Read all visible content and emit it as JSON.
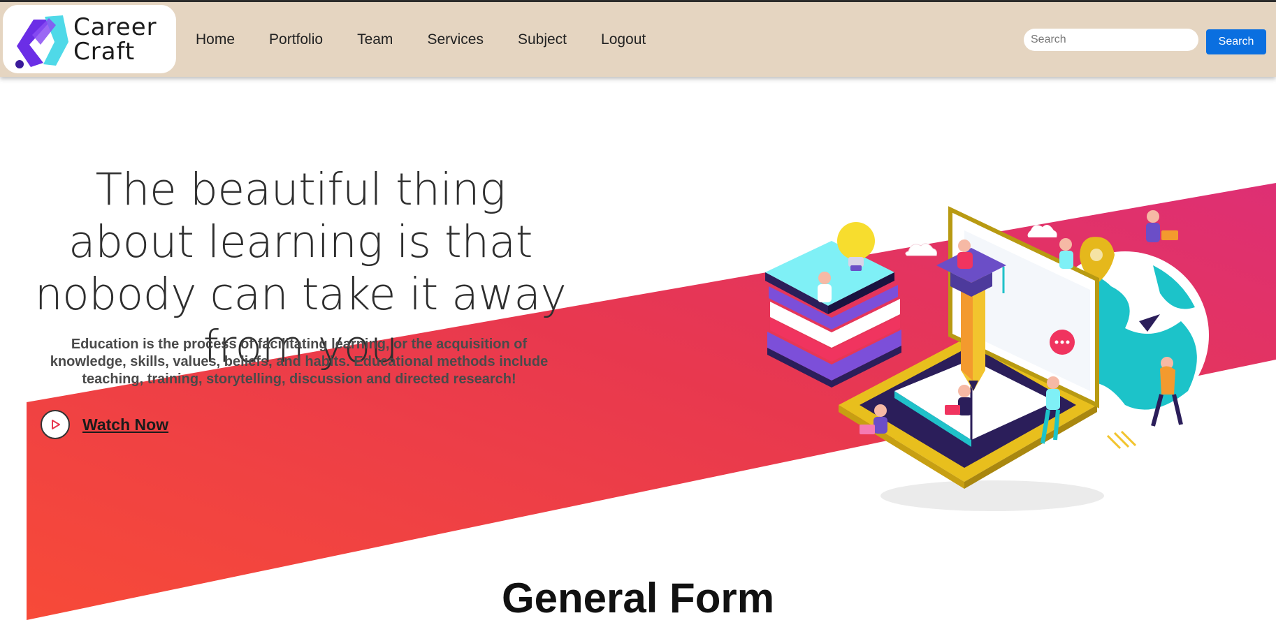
{
  "brand": {
    "line1": "Career",
    "line2": "Craft"
  },
  "nav": {
    "items": [
      "Home",
      "Portfolio",
      "Team",
      "Services",
      "Subject",
      "Logout"
    ]
  },
  "search": {
    "placeholder": "Search",
    "value": "",
    "button_label": "Search"
  },
  "hero": {
    "title": "The beautiful thing about learning is that nobody can take it away from you",
    "description": "Education is the process of facilitating learning, or the acquisition of knowledge, skills, values, beliefs, and habits. Educational methods include teaching, training, storytelling, discussion and directed research!",
    "watch_label": "Watch Now"
  },
  "section": {
    "title": "General Form"
  },
  "colors": {
    "navbar_bg": "#e5d5c1",
    "band_start": "#f74a38",
    "band_end": "#e0306a",
    "search_button": "#0a6fe0",
    "logo_cyan": "#4fd9e8",
    "logo_purple": "#6b2ee6"
  }
}
